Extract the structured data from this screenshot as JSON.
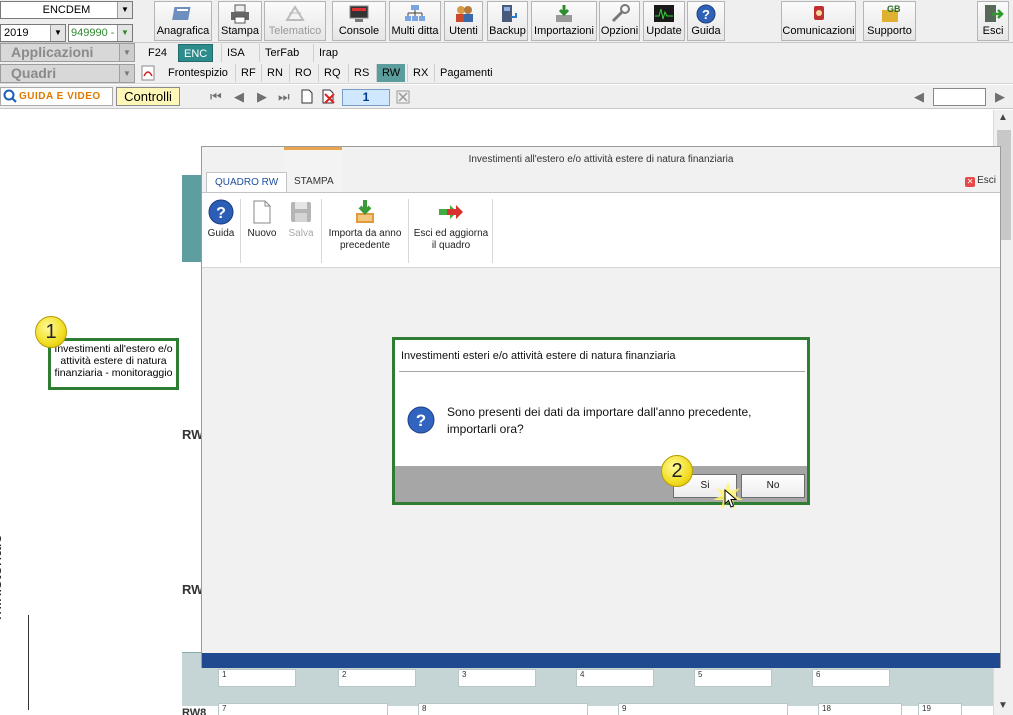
{
  "toolbar": {
    "company": "ENCDEM",
    "year": "2019",
    "code": "949990 -",
    "buttons": [
      {
        "label": "Anagrafica",
        "icon": "address-book-icon"
      },
      {
        "label": "Stampa",
        "icon": "printer-icon"
      },
      {
        "label": "Telematico",
        "icon": "telematico-icon",
        "disabled": true
      },
      {
        "label": "Console",
        "icon": "console-icon"
      },
      {
        "label": "Multi ditta",
        "icon": "multi-company-icon"
      },
      {
        "label": "Utenti",
        "icon": "users-icon"
      },
      {
        "label": "Backup",
        "icon": "backup-icon"
      },
      {
        "label": "Importazioni",
        "icon": "import-icon"
      },
      {
        "label": "Opzioni",
        "icon": "options-icon"
      },
      {
        "label": "Update",
        "icon": "update-icon"
      },
      {
        "label": "Guida",
        "icon": "help-icon"
      }
    ],
    "right_buttons": [
      {
        "label": "Comunicazioni",
        "icon": "communications-icon"
      },
      {
        "label": "Supporto",
        "icon": "support-icon"
      },
      {
        "label": "Esci",
        "icon": "exit-icon"
      }
    ]
  },
  "row2": {
    "select": "Applicazioni",
    "tabs": [
      "F24",
      "ENC",
      "ISA",
      "TerFab",
      "Irap"
    ]
  },
  "row3": {
    "select": "Quadri",
    "tabs": [
      "Frontespizio",
      "RF",
      "RN",
      "RO",
      "RQ",
      "RS",
      "RW",
      "RX",
      "Pagamenti"
    ]
  },
  "row4": {
    "guida": "GUIDA E VIDEO",
    "controlli": "Controlli",
    "page": "1"
  },
  "background": {
    "vertical_text": "ministeriale",
    "row_labels": [
      "RW",
      "RW",
      "RW8"
    ],
    "grid_top_nums": [
      "1",
      "2",
      "3",
      "4",
      "5",
      "6"
    ],
    "grid_bottom_nums": [
      "7",
      "8",
      "9",
      "18",
      "19"
    ]
  },
  "callouts": {
    "one_num": "1",
    "one_text": "Investimenti all'estero e/o attività estere di natura finanziaria - monitoraggio",
    "two_num": "2"
  },
  "window": {
    "title": "Investimenti all'estero e/o attività estere di natura finanziaria",
    "tab_active": "QUADRO RW",
    "tab_other": "STAMPA",
    "esci": "Esci",
    "ribbon": [
      {
        "label": "Guida",
        "icon": "help-icon"
      },
      {
        "label": "Nuovo",
        "icon": "new-document-icon"
      },
      {
        "label": "Salva",
        "icon": "save-icon",
        "disabled": true
      },
      {
        "label": "Importa da anno\nprecedente",
        "icon": "import-previous-year-icon"
      },
      {
        "label": "Esci ed aggiorna\nil quadro",
        "icon": "exit-update-icon"
      }
    ]
  },
  "dialog": {
    "title": "Investimenti esteri e/o attività estere di natura finanziaria",
    "message": "Sono presenti dei dati da importare dall'anno precedente, importarli ora?",
    "yes": "Si",
    "no": "No"
  }
}
